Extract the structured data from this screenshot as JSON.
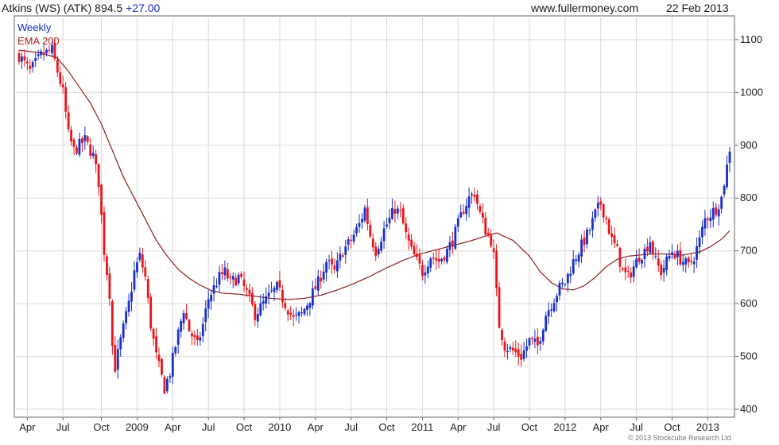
{
  "header": {
    "title": "Atkins (WS) (ATK) 894.5",
    "change": "+27.00",
    "site": "www.fullermoney.com",
    "date": "22 Feb 2013"
  },
  "copyright": "© 2013 Stockcube Research Ltd",
  "colors": {
    "up": "#1a2fc9",
    "down": "#e8141a",
    "ema": "#8e1d1d",
    "grid": "#d9d9d9"
  },
  "chart_data": {
    "type": "candlestick",
    "legend": [
      "Weekly",
      "EMA 200"
    ],
    "ylim": [
      385,
      1145
    ],
    "yticks": [
      400,
      500,
      600,
      700,
      800,
      900,
      1000,
      1100
    ],
    "xlim": [
      0,
      259
    ],
    "xticks": [
      {
        "label": "Apr",
        "week": 3
      },
      {
        "label": "Jul",
        "week": 16
      },
      {
        "label": "Oct",
        "week": 30
      },
      {
        "label": "2009",
        "week": 43
      },
      {
        "label": "Apr",
        "week": 56
      },
      {
        "label": "Jul",
        "week": 69
      },
      {
        "label": "Oct",
        "week": 82
      },
      {
        "label": "2010",
        "week": 95
      },
      {
        "label": "Apr",
        "week": 108
      },
      {
        "label": "Jul",
        "week": 121
      },
      {
        "label": "Oct",
        "week": 134
      },
      {
        "label": "2011",
        "week": 147
      },
      {
        "label": "Apr",
        "week": 160
      },
      {
        "label": "Jul",
        "week": 173
      },
      {
        "label": "Oct",
        "week": 186
      },
      {
        "label": "2012",
        "week": 199
      },
      {
        "label": "Apr",
        "week": 212
      },
      {
        "label": "Jul",
        "week": 225
      },
      {
        "label": "Oct",
        "week": 238
      },
      {
        "label": "2013",
        "week": 251
      }
    ],
    "close_anchors": [
      [
        0,
        1070
      ],
      [
        4,
        1040
      ],
      [
        8,
        1070
      ],
      [
        12,
        1080
      ],
      [
        14,
        1040
      ],
      [
        16,
        1000
      ],
      [
        18,
        920
      ],
      [
        20,
        890
      ],
      [
        24,
        910
      ],
      [
        27,
        880
      ],
      [
        29,
        830
      ],
      [
        31,
        700
      ],
      [
        33,
        620
      ],
      [
        34,
        520
      ],
      [
        35,
        480
      ],
      [
        37,
        530
      ],
      [
        40,
        600
      ],
      [
        42,
        660
      ],
      [
        44,
        690
      ],
      [
        46,
        650
      ],
      [
        48,
        560
      ],
      [
        50,
        500
      ],
      [
        53,
        440
      ],
      [
        55,
        470
      ],
      [
        57,
        520
      ],
      [
        60,
        590
      ],
      [
        62,
        550
      ],
      [
        65,
        520
      ],
      [
        67,
        560
      ],
      [
        69,
        610
      ],
      [
        71,
        630
      ],
      [
        73,
        650
      ],
      [
        75,
        660
      ],
      [
        77,
        640
      ],
      [
        80,
        650
      ],
      [
        83,
        620
      ],
      [
        86,
        580
      ],
      [
        89,
        600
      ],
      [
        92,
        620
      ],
      [
        94,
        630
      ],
      [
        97,
        600
      ],
      [
        100,
        570
      ],
      [
        103,
        580
      ],
      [
        106,
        610
      ],
      [
        109,
        640
      ],
      [
        112,
        680
      ],
      [
        115,
        660
      ],
      [
        118,
        700
      ],
      [
        121,
        720
      ],
      [
        124,
        750
      ],
      [
        126,
        780
      ],
      [
        128,
        730
      ],
      [
        130,
        700
      ],
      [
        133,
        740
      ],
      [
        135,
        760
      ],
      [
        137,
        780
      ],
      [
        139,
        770
      ],
      [
        141,
        730
      ],
      [
        143,
        700
      ],
      [
        145,
        680
      ],
      [
        147,
        660
      ],
      [
        150,
        690
      ],
      [
        153,
        680
      ],
      [
        156,
        700
      ],
      [
        158,
        720
      ],
      [
        160,
        750
      ],
      [
        162,
        780
      ],
      [
        164,
        800
      ],
      [
        166,
        810
      ],
      [
        168,
        770
      ],
      [
        170,
        740
      ],
      [
        172,
        720
      ],
      [
        173,
        690
      ],
      [
        174,
        620
      ],
      [
        175,
        560
      ],
      [
        177,
        520
      ],
      [
        180,
        510
      ],
      [
        183,
        500
      ],
      [
        186,
        530
      ],
      [
        189,
        520
      ],
      [
        192,
        580
      ],
      [
        195,
        610
      ],
      [
        197,
        630
      ],
      [
        199,
        640
      ],
      [
        202,
        680
      ],
      [
        205,
        710
      ],
      [
        208,
        740
      ],
      [
        210,
        770
      ],
      [
        212,
        790
      ],
      [
        214,
        760
      ],
      [
        216,
        720
      ],
      [
        218,
        700
      ],
      [
        220,
        660
      ],
      [
        222,
        650
      ],
      [
        224,
        670
      ],
      [
        226,
        690
      ],
      [
        228,
        700
      ],
      [
        230,
        720
      ],
      [
        232,
        680
      ],
      [
        234,
        660
      ],
      [
        236,
        680
      ],
      [
        238,
        700
      ],
      [
        240,
        690
      ],
      [
        242,
        680
      ],
      [
        244,
        670
      ],
      [
        246,
        690
      ],
      [
        248,
        720
      ],
      [
        250,
        760
      ],
      [
        252,
        770
      ],
      [
        254,
        780
      ],
      [
        256,
        800
      ],
      [
        257,
        830
      ],
      [
        258,
        860
      ],
      [
        259,
        894.5
      ]
    ],
    "ema200_anchors": [
      [
        0,
        1080
      ],
      [
        8,
        1075
      ],
      [
        14,
        1065
      ],
      [
        18,
        1040
      ],
      [
        22,
        1010
      ],
      [
        26,
        980
      ],
      [
        30,
        940
      ],
      [
        34,
        890
      ],
      [
        38,
        840
      ],
      [
        42,
        800
      ],
      [
        46,
        760
      ],
      [
        50,
        720
      ],
      [
        54,
        690
      ],
      [
        58,
        665
      ],
      [
        62,
        648
      ],
      [
        66,
        635
      ],
      [
        70,
        625
      ],
      [
        74,
        620
      ],
      [
        80,
        618
      ],
      [
        86,
        614
      ],
      [
        92,
        610
      ],
      [
        98,
        608
      ],
      [
        104,
        610
      ],
      [
        110,
        616
      ],
      [
        116,
        626
      ],
      [
        122,
        638
      ],
      [
        128,
        652
      ],
      [
        134,
        668
      ],
      [
        140,
        682
      ],
      [
        146,
        694
      ],
      [
        152,
        702
      ],
      [
        158,
        710
      ],
      [
        164,
        718
      ],
      [
        170,
        728
      ],
      [
        174,
        734
      ],
      [
        180,
        720
      ],
      [
        186,
        690
      ],
      [
        190,
        660
      ],
      [
        194,
        640
      ],
      [
        198,
        628
      ],
      [
        202,
        626
      ],
      [
        206,
        634
      ],
      [
        210,
        650
      ],
      [
        214,
        670
      ],
      [
        218,
        684
      ],
      [
        222,
        690
      ],
      [
        226,
        692
      ],
      [
        230,
        694
      ],
      [
        236,
        694
      ],
      [
        242,
        692
      ],
      [
        248,
        698
      ],
      [
        252,
        708
      ],
      [
        256,
        722
      ],
      [
        259,
        738
      ]
    ]
  }
}
